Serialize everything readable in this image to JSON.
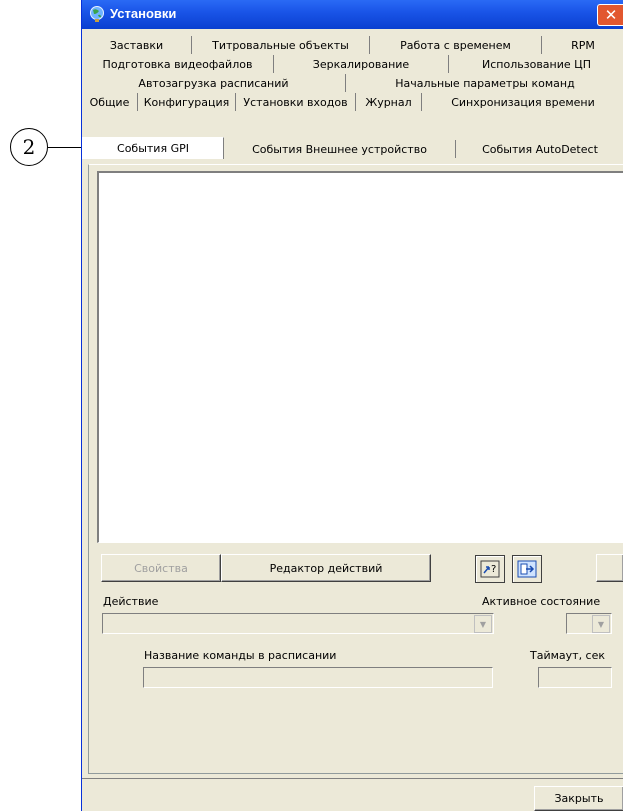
{
  "callout": {
    "number": "2"
  },
  "window": {
    "title": "Установки",
    "close_glyph": "✕",
    "title_icon": "globe-icon"
  },
  "tabs": {
    "row1": [
      "Заставки",
      "Титровальные объекты",
      "Работа с временем",
      "RPM"
    ],
    "row2": [
      "Подготовка видеофайлов",
      "Зеркалирование",
      "Использование ЦП"
    ],
    "row3": [
      "Автозагрузка расписаний",
      "Начальные параметры команд"
    ],
    "row4": [
      "Общие",
      "Конфигурация",
      "Установки входов",
      "Журнал",
      "Синхронизация времени"
    ],
    "row5": [
      "События GPI",
      "События Внешнее устройство",
      "События AutoDetect"
    ],
    "active": "События GPI"
  },
  "buttons": {
    "properties": "Свойства",
    "action_editor": "Редактор действий",
    "help_icon": "help-query-icon",
    "export_icon": "export-icon",
    "close": "Закрыть"
  },
  "form": {
    "action_label": "Действие",
    "active_state_label": "Активное состояние",
    "schedule_cmd_label": "Название команды в расписании",
    "timeout_label": "Таймаут, сек",
    "action_value": "",
    "active_state_value": "",
    "schedule_cmd_value": "",
    "timeout_value": ""
  },
  "colors": {
    "titlebar": "#0a3fd0",
    "window_bg": "#ece9d8",
    "close": "#e2572f"
  }
}
